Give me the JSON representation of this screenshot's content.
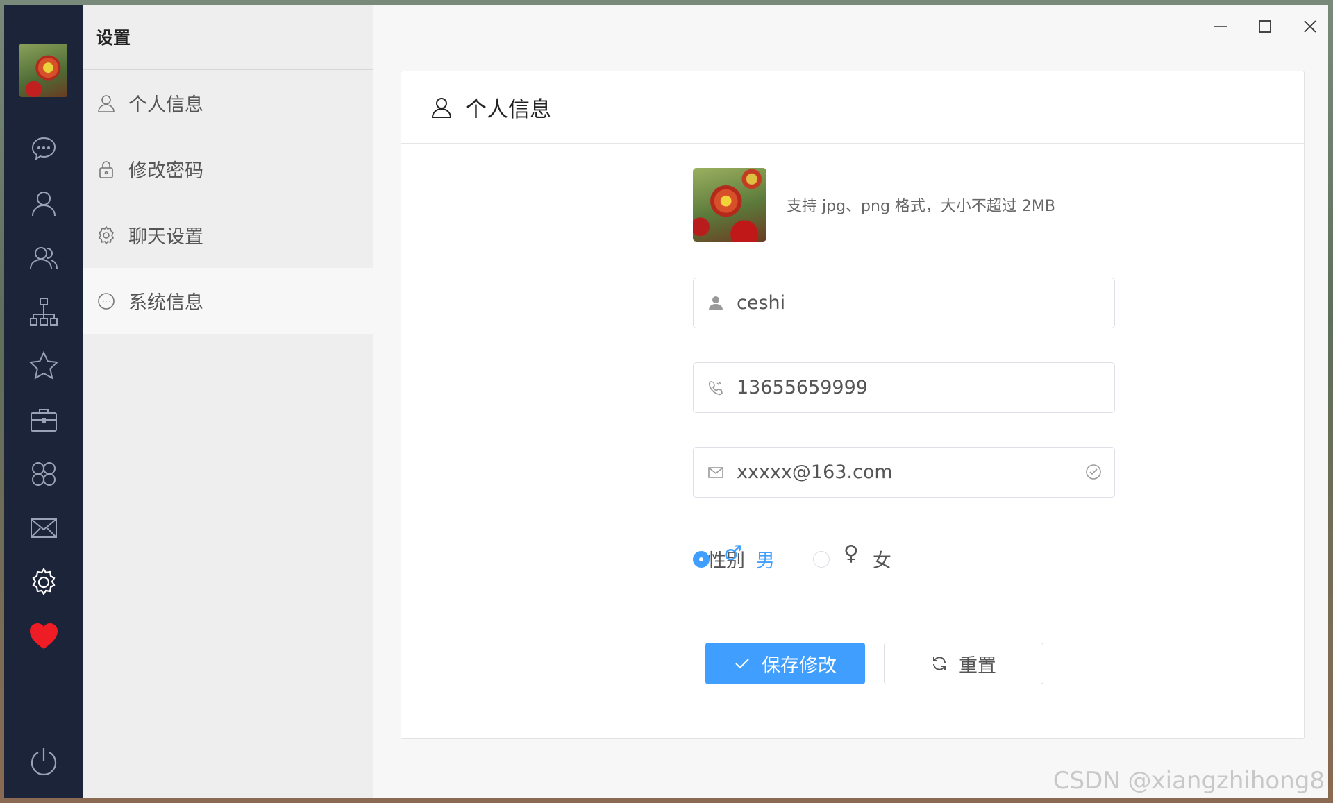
{
  "menu": {
    "title": "设置",
    "items": [
      {
        "label": "个人信息",
        "icon": "user-icon"
      },
      {
        "label": "修改密码",
        "icon": "lock-icon"
      },
      {
        "label": "聊天设置",
        "icon": "gear-icon"
      },
      {
        "label": "系统信息",
        "icon": "chat-icon"
      }
    ],
    "active_index": 3
  },
  "nav": {
    "icons": [
      "chat-bubble-icon",
      "user-icon",
      "group-icon",
      "org-chart-icon",
      "star-icon",
      "briefcase-icon",
      "apps-icon",
      "mail-icon",
      "settings-icon",
      "heart-icon"
    ],
    "bottom_icon": "power-icon"
  },
  "card": {
    "title": "个人信息",
    "avatar": {
      "label": "头像",
      "hint": "支持 jpg、png 格式，大小不超过 2MB"
    },
    "name": {
      "label": "名称",
      "value": "ceshi"
    },
    "phone": {
      "label": "手机",
      "value": "13655659999"
    },
    "email": {
      "label": "邮箱",
      "value": "xxxxx@163.com"
    },
    "gender": {
      "label": "性别",
      "options": [
        {
          "symbol": "♂",
          "label": "男",
          "checked": true
        },
        {
          "symbol": "♀",
          "label": "女",
          "checked": false
        }
      ]
    },
    "save_label": "保存修改",
    "reset_label": "重置"
  },
  "colors": {
    "primary": "#409eff",
    "nav_bg": "#1c2439",
    "required": "#f56c6c",
    "heart": "#ee1c24"
  },
  "watermark": "CSDN @xiangzhihong8"
}
